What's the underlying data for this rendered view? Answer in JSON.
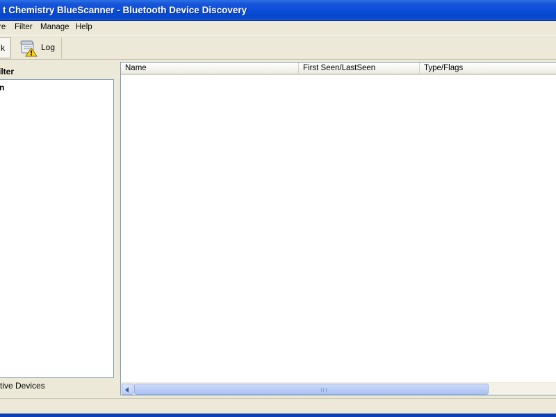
{
  "window": {
    "title": "Chemistry BlueScanner - Bluetooth Device Discovery",
    "title_visible": "t Chemistry BlueScanner - Bluetooth Device Discovery"
  },
  "menu": {
    "items": [
      "re",
      "Filter",
      "Manage",
      "Help"
    ]
  },
  "toolbar": {
    "pressed_label": "k",
    "log_label": "Log",
    "log_icon": "log-warning-icon"
  },
  "left_pane": {
    "header": "ilter",
    "tree_node": "n",
    "footer": "ctive Devices"
  },
  "list": {
    "columns": [
      "Name",
      "First Seen/LastSeen",
      "Type/Flags"
    ],
    "rows": []
  },
  "colors": {
    "titlebar": "#0a4cdc",
    "window_bg": "#ece9d8",
    "border": "#7f9db9"
  }
}
